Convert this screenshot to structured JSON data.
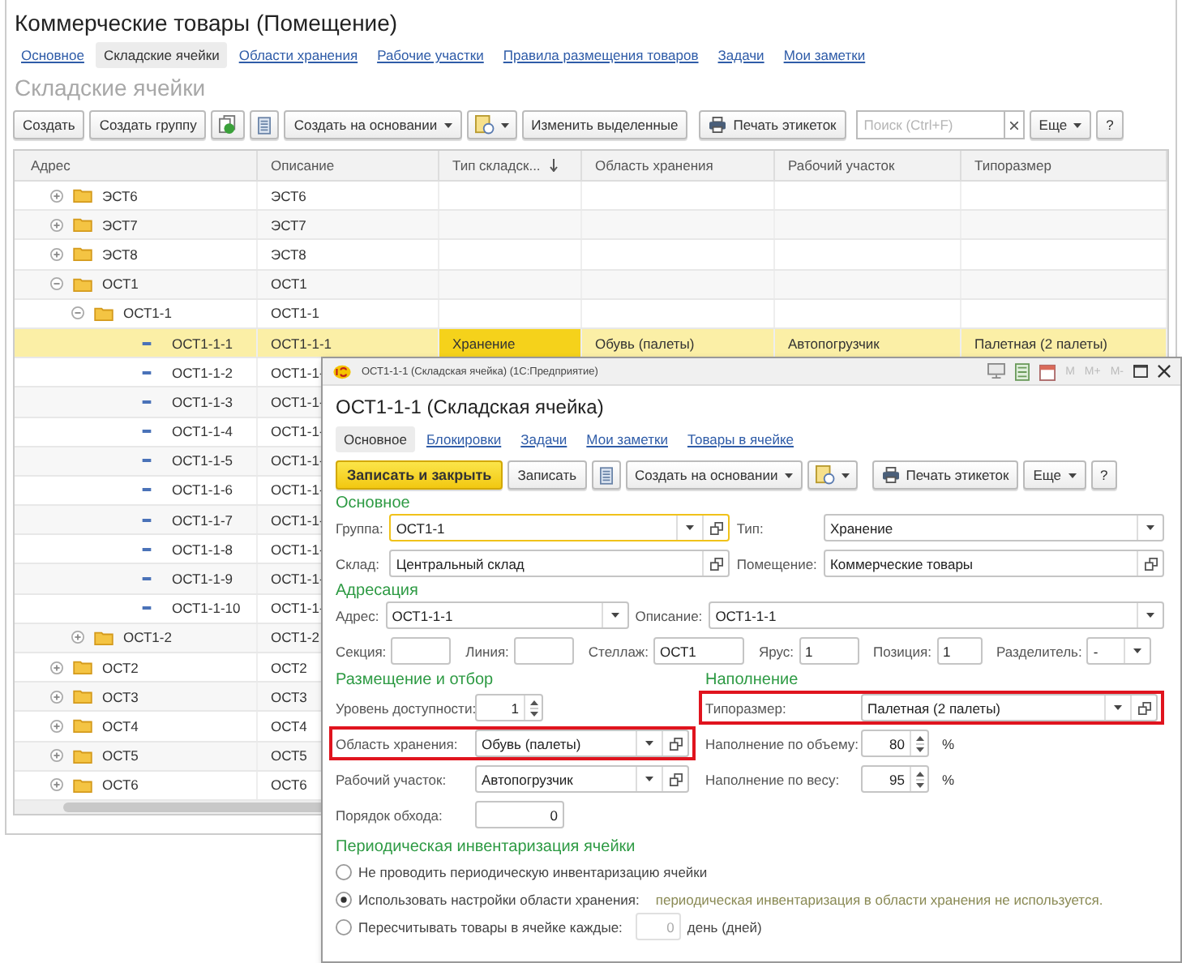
{
  "window": {
    "title": "Коммерческие товары (Помещение)"
  },
  "tabs": [
    {
      "label": "Основное",
      "selected": false
    },
    {
      "label": "Складские ячейки",
      "selected": true
    },
    {
      "label": "Области хранения",
      "selected": false
    },
    {
      "label": "Рабочие участки",
      "selected": false
    },
    {
      "label": "Правила размещения товаров",
      "selected": false
    },
    {
      "label": "Задачи",
      "selected": false
    },
    {
      "label": "Мои заметки",
      "selected": false
    }
  ],
  "section_title": "Складские ячейки",
  "toolbar": [
    {
      "kind": "text",
      "label": "Создать"
    },
    {
      "kind": "text",
      "label": "Создать группу"
    },
    {
      "kind": "copy"
    },
    {
      "kind": "list"
    },
    {
      "kind": "menu",
      "label": "Создать на основании"
    },
    {
      "kind": "report"
    },
    {
      "kind": "text",
      "label": "Изменить выделенные"
    },
    {
      "kind": "print",
      "label": "Печать этикеток"
    },
    {
      "kind": "search",
      "placeholder": "Поиск (Ctrl+F)"
    },
    {
      "kind": "menu",
      "label": "Еще"
    },
    {
      "kind": "text",
      "label": "?"
    }
  ],
  "table": {
    "columns": [
      {
        "label": "Адрес",
        "sorted": false,
        "current": false
      },
      {
        "label": "Описание",
        "sorted": false,
        "current": false
      },
      {
        "label": "Тип складск...",
        "sorted": true,
        "current": true
      },
      {
        "label": "Область хранения",
        "sorted": false,
        "current": false
      },
      {
        "label": "Рабочий участок",
        "sorted": false,
        "current": false
      },
      {
        "label": "Типоразмер",
        "sorted": false,
        "current": false
      }
    ],
    "rows": [
      {
        "kind": "group",
        "address": "ЭСТ6",
        "description": "ЭСТ6",
        "expanded": false,
        "selected": false
      },
      {
        "kind": "group",
        "address": "ЭСТ7",
        "description": "ЭСТ7",
        "expanded": false,
        "selected": false
      },
      {
        "kind": "group",
        "address": "ЭСТ8",
        "description": "ЭСТ8",
        "expanded": false,
        "selected": false
      },
      {
        "kind": "group",
        "address": "ОСТ1",
        "description": "ОСТ1",
        "expanded": true,
        "selected": false,
        "children": [
          {
            "kind": "group",
            "address": "ОСТ1-1",
            "description": "ОСТ1-1",
            "expanded": true,
            "selected": false,
            "children": [
              {
                "kind": "cell",
                "address": "ОСТ1-1-1",
                "description": "ОСТ1-1-1",
                "selected": true,
                "type": "Хранение",
                "area": "Обувь (палеты)",
                "workplace": "Автопогрузчик",
                "size": "Палетная (2 палеты)"
              },
              {
                "kind": "cell",
                "address": "ОСТ1-1-2",
                "description": "ОСТ1-1-",
                "selected": false
              },
              {
                "kind": "cell",
                "address": "ОСТ1-1-3",
                "description": "ОСТ1-1-",
                "selected": false
              },
              {
                "kind": "cell",
                "address": "ОСТ1-1-4",
                "description": "ОСТ1-1-",
                "selected": false
              },
              {
                "kind": "cell",
                "address": "ОСТ1-1-5",
                "description": "ОСТ1-1-",
                "selected": false
              },
              {
                "kind": "cell",
                "address": "ОСТ1-1-6",
                "description": "ОСТ1-1-",
                "selected": false
              },
              {
                "kind": "cell",
                "address": "ОСТ1-1-7",
                "description": "ОСТ1-1-",
                "selected": false
              },
              {
                "kind": "cell",
                "address": "ОСТ1-1-8",
                "description": "ОСТ1-1-",
                "selected": false
              },
              {
                "kind": "cell",
                "address": "ОСТ1-1-9",
                "description": "ОСТ1-1-",
                "selected": false
              },
              {
                "kind": "cell",
                "address": "ОСТ1-1-10",
                "description": "ОСТ1-1-",
                "selected": false
              }
            ]
          },
          {
            "kind": "group",
            "address": "ОСТ1-2",
            "description": "ОСТ1-2",
            "expanded": false,
            "selected": false
          }
        ]
      },
      {
        "kind": "group",
        "address": "ОСТ2",
        "description": "ОСТ2",
        "expanded": false,
        "selected": false
      },
      {
        "kind": "group",
        "address": "ОСТ3",
        "description": "ОСТ3",
        "expanded": false,
        "selected": false
      },
      {
        "kind": "group",
        "address": "ОСТ4",
        "description": "ОСТ4",
        "expanded": false,
        "selected": false
      },
      {
        "kind": "group",
        "address": "ОСТ5",
        "description": "ОСТ5",
        "expanded": false,
        "selected": false
      },
      {
        "kind": "group",
        "address": "ОСТ6",
        "description": "ОСТ6",
        "expanded": false,
        "selected": false
      }
    ]
  },
  "dialog": {
    "title": "ОСТ1-1-1 (Складская ячейка) (1С:Предприятие)",
    "memory_buttons": [
      "M",
      "M+",
      "M-"
    ],
    "heading": "ОСТ1-1-1 (Складская ячейка)",
    "tabs": [
      {
        "label": "Основное",
        "selected": true
      },
      {
        "label": "Блокировки",
        "selected": false
      },
      {
        "label": "Задачи",
        "selected": false
      },
      {
        "label": "Мои заметки",
        "selected": false
      },
      {
        "label": "Товары в ячейке",
        "selected": false
      }
    ],
    "toolbar": [
      {
        "kind": "primary",
        "label": "Записать и закрыть"
      },
      {
        "kind": "text",
        "label": "Записать"
      },
      {
        "kind": "list"
      },
      {
        "kind": "menu",
        "label": "Создать на основании"
      },
      {
        "kind": "report"
      },
      {
        "kind": "print",
        "label": "Печать этикеток"
      },
      {
        "kind": "menu",
        "label": "Еще"
      },
      {
        "kind": "text",
        "label": "?"
      }
    ],
    "basic": {
      "title": "Основное",
      "fields": [
        {
          "label": "Группа:",
          "value": "ОСТ1-1",
          "kind": "select_open",
          "focused": true
        },
        {
          "label": "Тип:",
          "value": "Хранение",
          "kind": "select",
          "focused": false
        },
        {
          "label": "Склад:",
          "value": "Центральный склад",
          "kind": "open",
          "focused": false
        },
        {
          "label": "Помещение:",
          "value": "Коммерческие товары",
          "kind": "open",
          "focused": false
        }
      ]
    },
    "addressing": {
      "title": "Адресация",
      "fields": [
        {
          "label": "Адрес:",
          "value": "ОСТ1-1-1",
          "kind": "select"
        },
        {
          "label": "Описание:",
          "value": "ОСТ1-1-1",
          "kind": "select"
        }
      ],
      "parts": [
        {
          "label": "Секция:",
          "kind": "text"
        },
        {
          "label": "Линия:",
          "kind": "text"
        },
        {
          "label": "Стеллаж:",
          "value": "ОСТ1",
          "kind": "text"
        },
        {
          "label": "Ярус:",
          "value": "1",
          "kind": "text"
        },
        {
          "label": "Позиция:",
          "value": "1",
          "kind": "text"
        },
        {
          "label": "Разделитель:",
          "value": "-",
          "kind": "select"
        }
      ]
    },
    "placement": {
      "title": "Размещение и отбор",
      "fields": [
        {
          "label": "Уровень доступности:",
          "value": "1",
          "kind": "spin",
          "highlighted": false
        },
        {
          "label": "Область хранения:",
          "value": "Обувь (палеты)",
          "kind": "select_open",
          "highlighted": true
        },
        {
          "label": "Рабочий участок:",
          "value": "Автопогрузчик",
          "kind": "select_open",
          "highlighted": false
        },
        {
          "label": "Порядок обхода:",
          "value": "0",
          "kind": "number",
          "highlighted": false
        }
      ]
    },
    "filling": {
      "title": "Наполнение",
      "fields": [
        {
          "label": "Типоразмер:",
          "value": "Палетная (2 палеты)",
          "kind": "select_open",
          "highlighted": true
        },
        {
          "label": "Наполнение по объему:",
          "value": "80",
          "kind": "spin",
          "unit": "%",
          "highlighted": false
        },
        {
          "label": "Наполнение по весу:",
          "value": "95",
          "kind": "spin",
          "unit": "%",
          "highlighted": false
        }
      ]
    },
    "inventory": {
      "title": "Периодическая инвентаризация ячейки",
      "options": [
        {
          "label": "Не проводить периодическую инвентаризацию ячейки",
          "selected": false
        },
        {
          "label": "Использовать настройки области хранения:",
          "selected": true,
          "note": "периодическая инвентаризация в области хранения не используется."
        },
        {
          "label": "Пересчитывать товары в ячейке каждые:",
          "selected": false,
          "value": "0",
          "input_disabled": true,
          "unit": "день (дней)"
        }
      ]
    }
  }
}
